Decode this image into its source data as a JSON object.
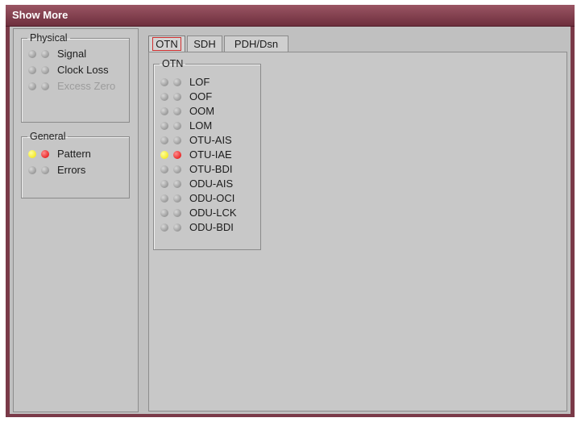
{
  "window": {
    "title": "Show More"
  },
  "physical": {
    "legend": "Physical",
    "items": [
      {
        "label": "Signal",
        "led1": "gray",
        "led2": "gray",
        "disabled": false
      },
      {
        "label": "Clock Loss",
        "led1": "gray",
        "led2": "gray",
        "disabled": false
      },
      {
        "label": "Excess Zero",
        "led1": "gray",
        "led2": "gray",
        "disabled": true
      }
    ]
  },
  "general": {
    "legend": "General",
    "items": [
      {
        "label": "Pattern",
        "led1": "yellow",
        "led2": "red"
      },
      {
        "label": "Errors",
        "led1": "gray",
        "led2": "gray"
      }
    ]
  },
  "tabs": {
    "items": [
      "OTN",
      "SDH",
      "PDH/Dsn"
    ],
    "active": "OTN"
  },
  "otn": {
    "legend": "OTN",
    "items": [
      {
        "label": "LOF",
        "led1": "gray",
        "led2": "gray"
      },
      {
        "label": "OOF",
        "led1": "gray",
        "led2": "gray"
      },
      {
        "label": "OOM",
        "led1": "gray",
        "led2": "gray"
      },
      {
        "label": "LOM",
        "led1": "gray",
        "led2": "gray"
      },
      {
        "label": "OTU-AIS",
        "led1": "gray",
        "led2": "gray"
      },
      {
        "label": "OTU-IAE",
        "led1": "yellow",
        "led2": "red"
      },
      {
        "label": "OTU-BDI",
        "led1": "gray",
        "led2": "gray"
      },
      {
        "label": "ODU-AIS",
        "led1": "gray",
        "led2": "gray"
      },
      {
        "label": "ODU-OCI",
        "led1": "gray",
        "led2": "gray"
      },
      {
        "label": "ODU-LCK",
        "led1": "gray",
        "led2": "gray"
      },
      {
        "label": "ODU-BDI",
        "led1": "gray",
        "led2": "gray"
      }
    ]
  },
  "colors": {
    "titlebar": "#7a3a48",
    "led_yellow": "#f0e000",
    "led_red": "#e00000",
    "led_gray": "#9a9a9a",
    "tab_active_outline": "#d03030"
  }
}
